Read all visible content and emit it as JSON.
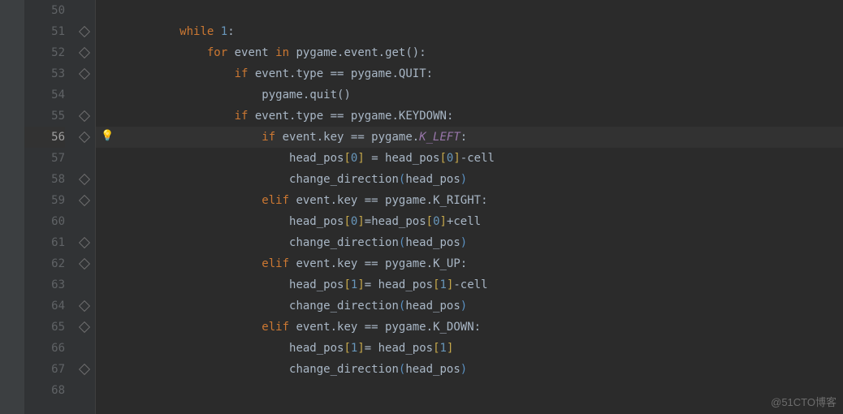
{
  "watermark": "@51CTO博客",
  "highlighted_line": 56,
  "gutter": {
    "start": 50,
    "end": 68
  },
  "code": [
    {
      "n": 50,
      "indent": 0,
      "tokens": []
    },
    {
      "n": 51,
      "indent": 8,
      "tokens": [
        {
          "t": "while",
          "c": "kw"
        },
        {
          "t": " ",
          "c": "id"
        },
        {
          "t": "1",
          "c": "num"
        },
        {
          "t": ":",
          "c": "pn"
        }
      ]
    },
    {
      "n": 52,
      "indent": 12,
      "tokens": [
        {
          "t": "for",
          "c": "kw"
        },
        {
          "t": " event ",
          "c": "id"
        },
        {
          "t": "in",
          "c": "kw"
        },
        {
          "t": " pygame",
          "c": "id"
        },
        {
          "t": ".",
          "c": "pn"
        },
        {
          "t": "event",
          "c": "id"
        },
        {
          "t": ".",
          "c": "pn"
        },
        {
          "t": "get",
          "c": "id"
        },
        {
          "t": "()",
          "c": "pn"
        },
        {
          "t": ":",
          "c": "pn"
        }
      ]
    },
    {
      "n": 53,
      "indent": 16,
      "tokens": [
        {
          "t": "if",
          "c": "kw"
        },
        {
          "t": " event",
          "c": "id"
        },
        {
          "t": ".",
          "c": "pn"
        },
        {
          "t": "type ",
          "c": "id"
        },
        {
          "t": "==",
          "c": "pn"
        },
        {
          "t": " pygame",
          "c": "id"
        },
        {
          "t": ".",
          "c": "pn"
        },
        {
          "t": "QUIT",
          "c": "id"
        },
        {
          "t": ":",
          "c": "pn"
        }
      ]
    },
    {
      "n": 54,
      "indent": 20,
      "tokens": [
        {
          "t": "pygame",
          "c": "id"
        },
        {
          "t": ".",
          "c": "pn"
        },
        {
          "t": "quit",
          "c": "id"
        },
        {
          "t": "()",
          "c": "pn"
        }
      ]
    },
    {
      "n": 55,
      "indent": 16,
      "tokens": [
        {
          "t": "if",
          "c": "kw"
        },
        {
          "t": " event",
          "c": "id"
        },
        {
          "t": ".",
          "c": "pn"
        },
        {
          "t": "type ",
          "c": "id"
        },
        {
          "t": "==",
          "c": "pn"
        },
        {
          "t": " pygame",
          "c": "id"
        },
        {
          "t": ".",
          "c": "pn"
        },
        {
          "t": "KEYDOWN",
          "c": "id"
        },
        {
          "t": ":",
          "c": "pn"
        }
      ]
    },
    {
      "n": 56,
      "indent": 20,
      "tokens": [
        {
          "t": "if",
          "c": "kw"
        },
        {
          "t": " event",
          "c": "id"
        },
        {
          "t": ".",
          "c": "pn"
        },
        {
          "t": "key ",
          "c": "id"
        },
        {
          "t": "==",
          "c": "pn"
        },
        {
          "t": " pygame",
          "c": "id"
        },
        {
          "t": ".",
          "c": "pn"
        },
        {
          "t": "K_LEFT",
          "c": "const"
        },
        {
          "t": ":",
          "c": "pn"
        }
      ]
    },
    {
      "n": 57,
      "indent": 24,
      "tokens": [
        {
          "t": "head_pos",
          "c": "id"
        },
        {
          "t": "[",
          "c": "bkt-y"
        },
        {
          "t": "0",
          "c": "num"
        },
        {
          "t": "]",
          "c": "bkt-y"
        },
        {
          "t": " = head_pos",
          "c": "id"
        },
        {
          "t": "[",
          "c": "bkt-y"
        },
        {
          "t": "0",
          "c": "num"
        },
        {
          "t": "]",
          "c": "bkt-y"
        },
        {
          "t": "-cell",
          "c": "id"
        }
      ]
    },
    {
      "n": 58,
      "indent": 24,
      "tokens": [
        {
          "t": "change_direction",
          "c": "id"
        },
        {
          "t": "(",
          "c": "bkt-b"
        },
        {
          "t": "head_pos",
          "c": "id"
        },
        {
          "t": ")",
          "c": "bkt-b"
        }
      ]
    },
    {
      "n": 59,
      "indent": 20,
      "tokens": [
        {
          "t": "elif",
          "c": "kw"
        },
        {
          "t": " event",
          "c": "id"
        },
        {
          "t": ".",
          "c": "pn"
        },
        {
          "t": "key ",
          "c": "id"
        },
        {
          "t": "==",
          "c": "pn"
        },
        {
          "t": " pygame",
          "c": "id"
        },
        {
          "t": ".",
          "c": "pn"
        },
        {
          "t": "K_RIGHT",
          "c": "id"
        },
        {
          "t": ":",
          "c": "pn"
        }
      ]
    },
    {
      "n": 60,
      "indent": 24,
      "tokens": [
        {
          "t": "head_pos",
          "c": "id"
        },
        {
          "t": "[",
          "c": "bkt-y"
        },
        {
          "t": "0",
          "c": "num"
        },
        {
          "t": "]",
          "c": "bkt-y"
        },
        {
          "t": "=",
          "c": "pn"
        },
        {
          "t": "head_pos",
          "c": "id"
        },
        {
          "t": "[",
          "c": "bkt-y"
        },
        {
          "t": "0",
          "c": "num"
        },
        {
          "t": "]",
          "c": "bkt-y"
        },
        {
          "t": "+cell",
          "c": "id"
        }
      ]
    },
    {
      "n": 61,
      "indent": 24,
      "tokens": [
        {
          "t": "change_direction",
          "c": "id"
        },
        {
          "t": "(",
          "c": "bkt-b"
        },
        {
          "t": "head_pos",
          "c": "id"
        },
        {
          "t": ")",
          "c": "bkt-b"
        }
      ]
    },
    {
      "n": 62,
      "indent": 20,
      "tokens": [
        {
          "t": "elif",
          "c": "kw"
        },
        {
          "t": " event",
          "c": "id"
        },
        {
          "t": ".",
          "c": "pn"
        },
        {
          "t": "key ",
          "c": "id"
        },
        {
          "t": "==",
          "c": "pn"
        },
        {
          "t": " pygame",
          "c": "id"
        },
        {
          "t": ".",
          "c": "pn"
        },
        {
          "t": "K_UP",
          "c": "id"
        },
        {
          "t": ":",
          "c": "pn"
        }
      ]
    },
    {
      "n": 63,
      "indent": 24,
      "tokens": [
        {
          "t": "head_pos",
          "c": "id"
        },
        {
          "t": "[",
          "c": "bkt-y"
        },
        {
          "t": "1",
          "c": "num"
        },
        {
          "t": "]",
          "c": "bkt-y"
        },
        {
          "t": "=",
          "c": "pn"
        },
        {
          "t": " head_pos",
          "c": "id"
        },
        {
          "t": "[",
          "c": "bkt-y"
        },
        {
          "t": "1",
          "c": "num"
        },
        {
          "t": "]",
          "c": "bkt-y"
        },
        {
          "t": "-cell",
          "c": "id"
        }
      ]
    },
    {
      "n": 64,
      "indent": 24,
      "tokens": [
        {
          "t": "change_direction",
          "c": "id"
        },
        {
          "t": "(",
          "c": "bkt-b"
        },
        {
          "t": "head_pos",
          "c": "id"
        },
        {
          "t": ")",
          "c": "bkt-b"
        }
      ]
    },
    {
      "n": 65,
      "indent": 20,
      "tokens": [
        {
          "t": "elif",
          "c": "kw"
        },
        {
          "t": " event",
          "c": "id"
        },
        {
          "t": ".",
          "c": "pn"
        },
        {
          "t": "key ",
          "c": "id"
        },
        {
          "t": "==",
          "c": "pn"
        },
        {
          "t": " pygame",
          "c": "id"
        },
        {
          "t": ".",
          "c": "pn"
        },
        {
          "t": "K_DOWN",
          "c": "id"
        },
        {
          "t": ":",
          "c": "pn"
        }
      ]
    },
    {
      "n": 66,
      "indent": 24,
      "tokens": [
        {
          "t": "head_pos",
          "c": "id"
        },
        {
          "t": "[",
          "c": "bkt-y"
        },
        {
          "t": "1",
          "c": "num"
        },
        {
          "t": "]",
          "c": "bkt-y"
        },
        {
          "t": "=",
          "c": "pn"
        },
        {
          "t": " head_pos",
          "c": "id"
        },
        {
          "t": "[",
          "c": "bkt-y"
        },
        {
          "t": "1",
          "c": "num"
        },
        {
          "t": "]",
          "c": "bkt-y"
        }
      ]
    },
    {
      "n": 67,
      "indent": 24,
      "tokens": [
        {
          "t": "change_direction",
          "c": "id"
        },
        {
          "t": "(",
          "c": "bkt-b"
        },
        {
          "t": "head_pos",
          "c": "id"
        },
        {
          "t": ")",
          "c": "bkt-b"
        }
      ]
    },
    {
      "n": 68,
      "indent": 0,
      "tokens": []
    }
  ],
  "fold_markers": [
    51,
    52,
    53,
    55,
    56,
    58,
    59,
    61,
    62,
    64,
    65,
    67
  ],
  "bulb_line": 56
}
